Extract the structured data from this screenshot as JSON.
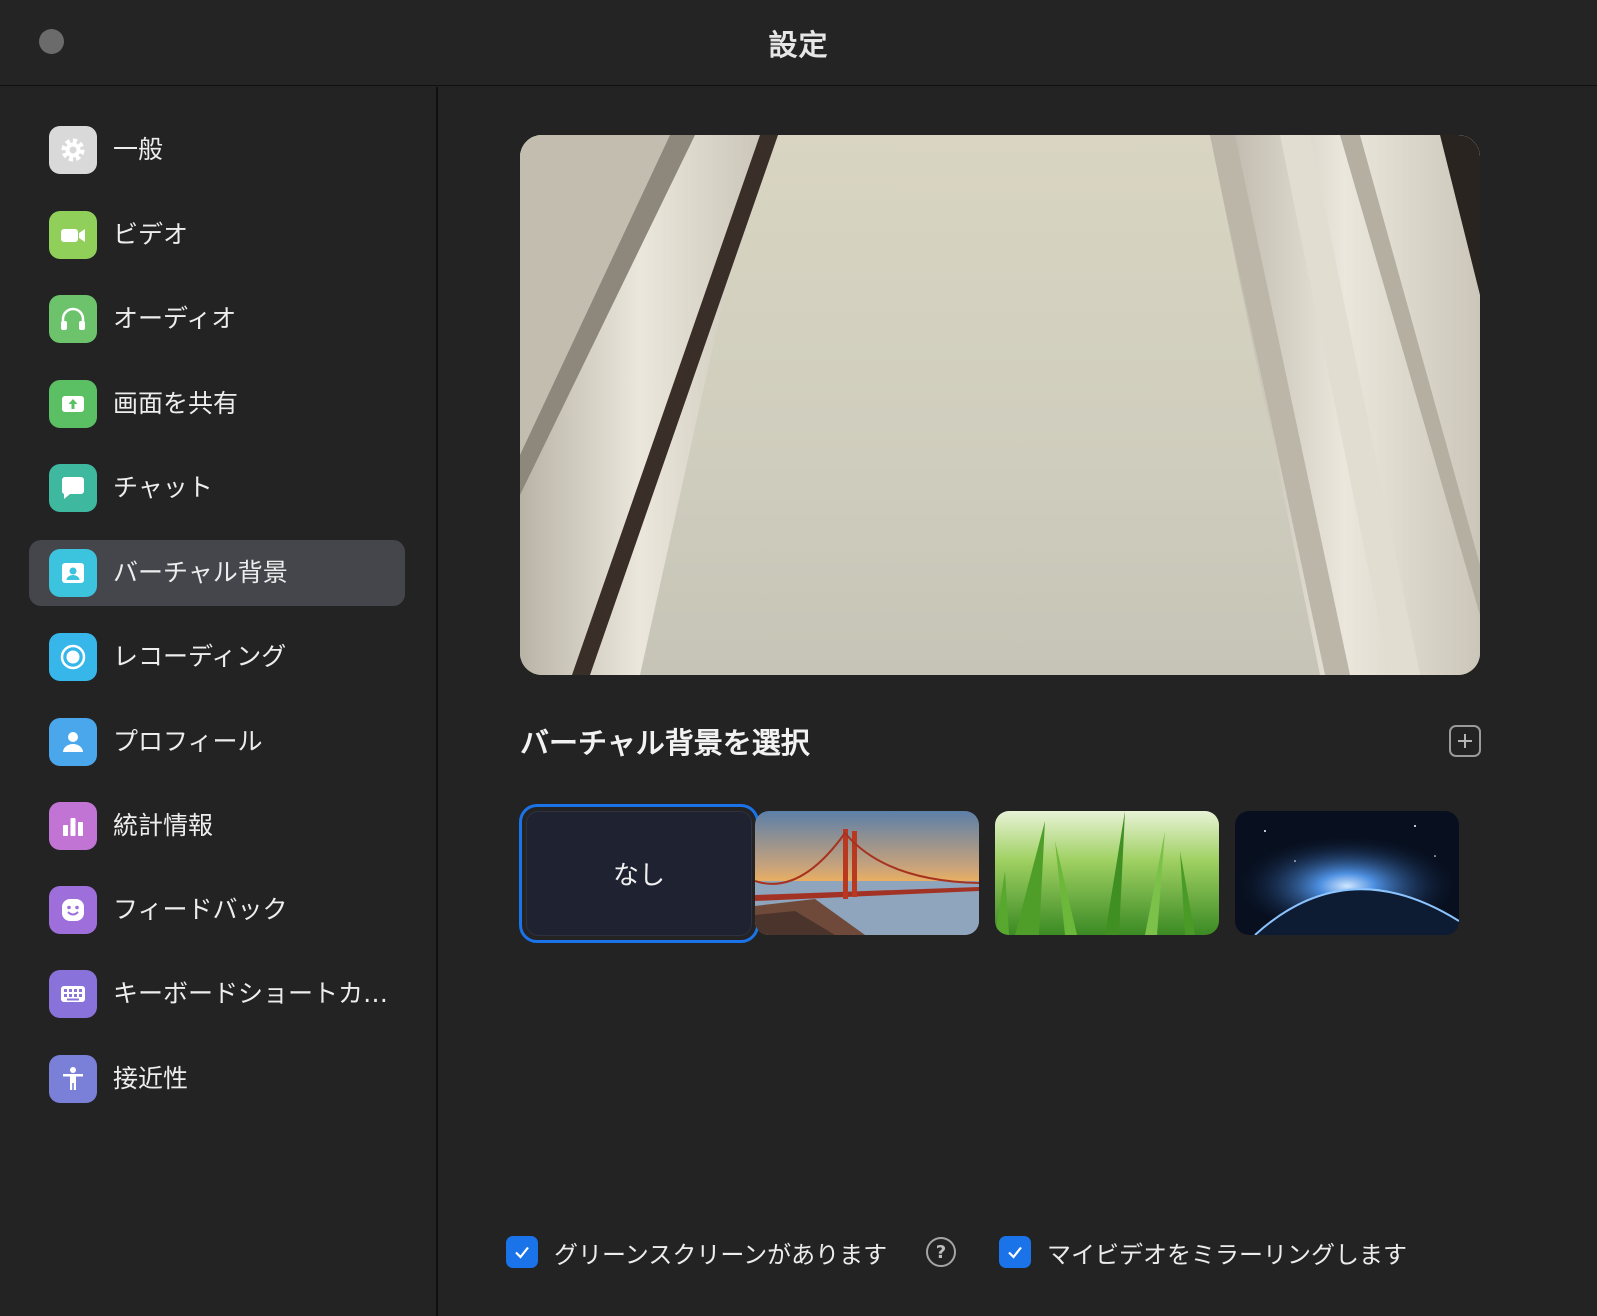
{
  "window": {
    "title": "設定"
  },
  "sidebar": {
    "items": [
      {
        "label": "一般",
        "icon": "gear-icon",
        "color": "#d9d9d9",
        "active": false
      },
      {
        "label": "ビデオ",
        "icon": "video-camera-icon",
        "color": "#8fcf5a",
        "active": false
      },
      {
        "label": "オーディオ",
        "icon": "headphones-icon",
        "color": "#6cc36b",
        "active": false
      },
      {
        "label": "画面を共有",
        "icon": "share-screen-icon",
        "color": "#5bbf63",
        "active": false
      },
      {
        "label": "チャット",
        "icon": "chat-bubble-icon",
        "color": "#3fb8a0",
        "active": false
      },
      {
        "label": "バーチャル背景",
        "icon": "virtual-background-icon",
        "color": "#3cc3de",
        "active": true
      },
      {
        "label": "レコーディング",
        "icon": "record-icon",
        "color": "#37b6ea",
        "active": false
      },
      {
        "label": "プロフィール",
        "icon": "profile-icon",
        "color": "#4aa7ec",
        "active": false
      },
      {
        "label": "統計情報",
        "icon": "statistics-icon",
        "color": "#c174d3",
        "active": false
      },
      {
        "label": "フィードバック",
        "icon": "smiley-face-icon",
        "color": "#9e6fdb",
        "active": false
      },
      {
        "label": "キーボードショートカ…",
        "icon": "keyboard-icon",
        "color": "#8a72db",
        "active": false
      },
      {
        "label": "接近性",
        "icon": "accessibility-icon",
        "color": "#7a80d8",
        "active": false
      }
    ]
  },
  "main": {
    "section_title": "バーチャル背景を選択",
    "backgrounds": [
      {
        "label": "なし",
        "selected": true
      },
      {
        "name": "golden-gate-bridge",
        "selected": false
      },
      {
        "name": "grass",
        "selected": false
      },
      {
        "name": "earth-from-space",
        "selected": false
      }
    ],
    "options": {
      "green_screen": {
        "label": "グリーンスクリーンがあります",
        "checked": true
      },
      "mirror_video": {
        "label": "マイビデオをミラーリングします",
        "checked": true
      }
    },
    "help_glyph": "?"
  },
  "colors": {
    "accent": "#1a73e8",
    "active_row": "#45464c"
  }
}
